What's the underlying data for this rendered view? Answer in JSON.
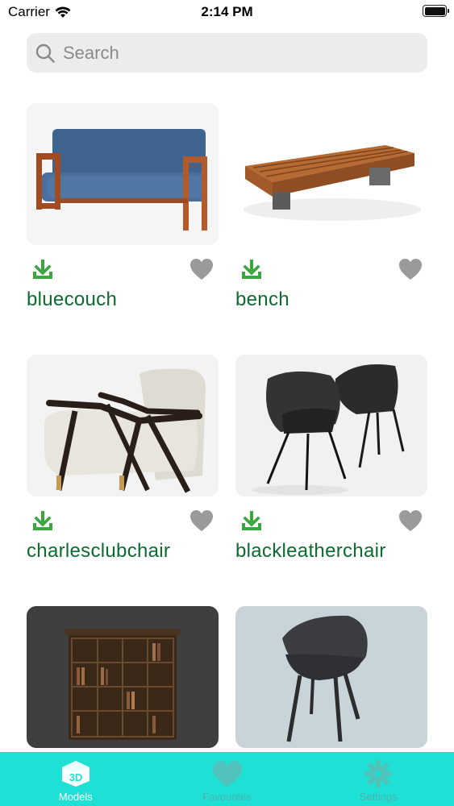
{
  "status_bar": {
    "carrier": "Carrier",
    "time": "2:14 PM"
  },
  "search": {
    "placeholder": "Search"
  },
  "colors": {
    "accent": "#1fe0d4",
    "title": "#0c6b30",
    "download": "#3aa63f",
    "heart_inactive": "#9a9a9a"
  },
  "models": [
    {
      "name": "bluecouch",
      "thumbnail": "blue couch",
      "favorite": false
    },
    {
      "name": "bench",
      "thumbnail": "wooden bench",
      "favorite": false
    },
    {
      "name": "charlesclubchair",
      "thumbnail": "club chair",
      "favorite": false
    },
    {
      "name": "blackleatherchair",
      "thumbnail": "black leather chairs",
      "favorite": false
    },
    {
      "name": "",
      "thumbnail": "bookshelf cabinet",
      "favorite": false
    },
    {
      "name": "",
      "thumbnail": "grey shell chair",
      "favorite": false
    }
  ],
  "tabs": [
    {
      "label": "Models",
      "icon": "cube-3d-icon",
      "active": true
    },
    {
      "label": "Favourites",
      "icon": "heart-icon",
      "active": false
    },
    {
      "label": "Settings",
      "icon": "gear-icon",
      "active": false
    }
  ]
}
